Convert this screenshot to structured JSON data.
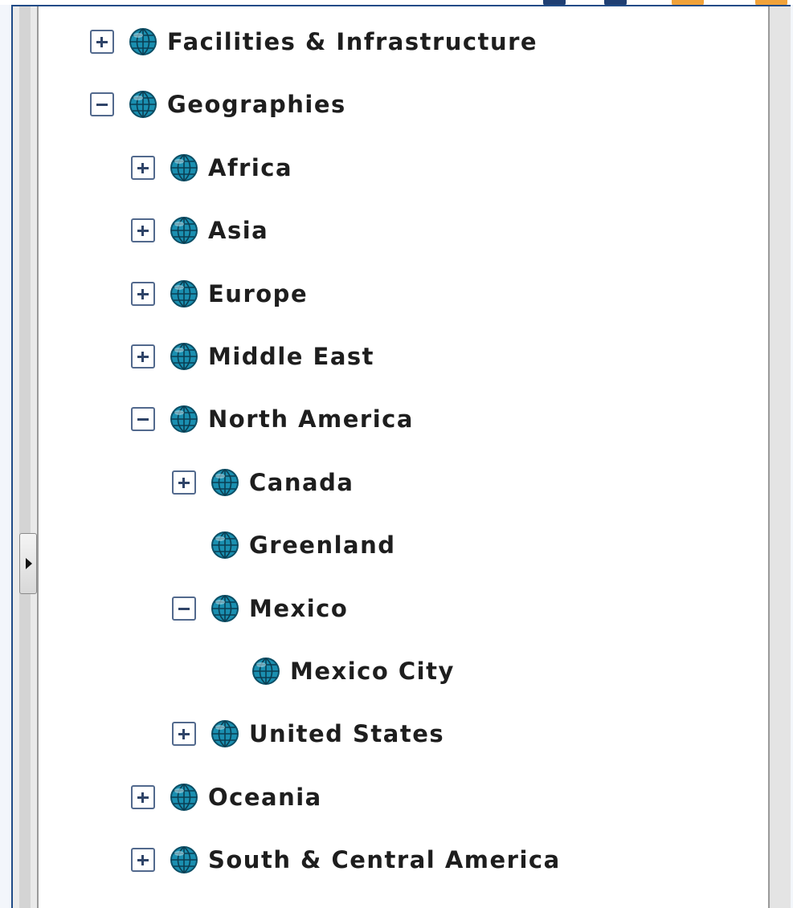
{
  "colors": {
    "accent": "#1f4b87",
    "globe": "#1a8fb0",
    "toggle_border": "#52698d",
    "tab_orange": "#f0a23a"
  },
  "tree": {
    "nodes": [
      {
        "label": "Facilities & Infrastructure",
        "level": 0,
        "toggle": "plus"
      },
      {
        "label": "Geographies",
        "level": 0,
        "toggle": "minus"
      },
      {
        "label": "Africa",
        "level": 1,
        "toggle": "plus"
      },
      {
        "label": "Asia",
        "level": 1,
        "toggle": "plus"
      },
      {
        "label": "Europe",
        "level": 1,
        "toggle": "plus"
      },
      {
        "label": "Middle East",
        "level": 1,
        "toggle": "plus"
      },
      {
        "label": "North America",
        "level": 1,
        "toggle": "minus"
      },
      {
        "label": "Canada",
        "level": 2,
        "toggle": "plus"
      },
      {
        "label": "Greenland",
        "level": 2,
        "toggle": "none"
      },
      {
        "label": "Mexico",
        "level": 2,
        "toggle": "minus"
      },
      {
        "label": "Mexico City",
        "level": 3,
        "toggle": "none"
      },
      {
        "label": "United States",
        "level": 2,
        "toggle": "plus"
      },
      {
        "label": "Oceania",
        "level": 1,
        "toggle": "plus"
      },
      {
        "label": "South & Central America",
        "level": 1,
        "toggle": "plus"
      }
    ],
    "icon": "globe-icon"
  },
  "panel": {
    "collapse_handle_icon": "triangle-right-icon"
  }
}
